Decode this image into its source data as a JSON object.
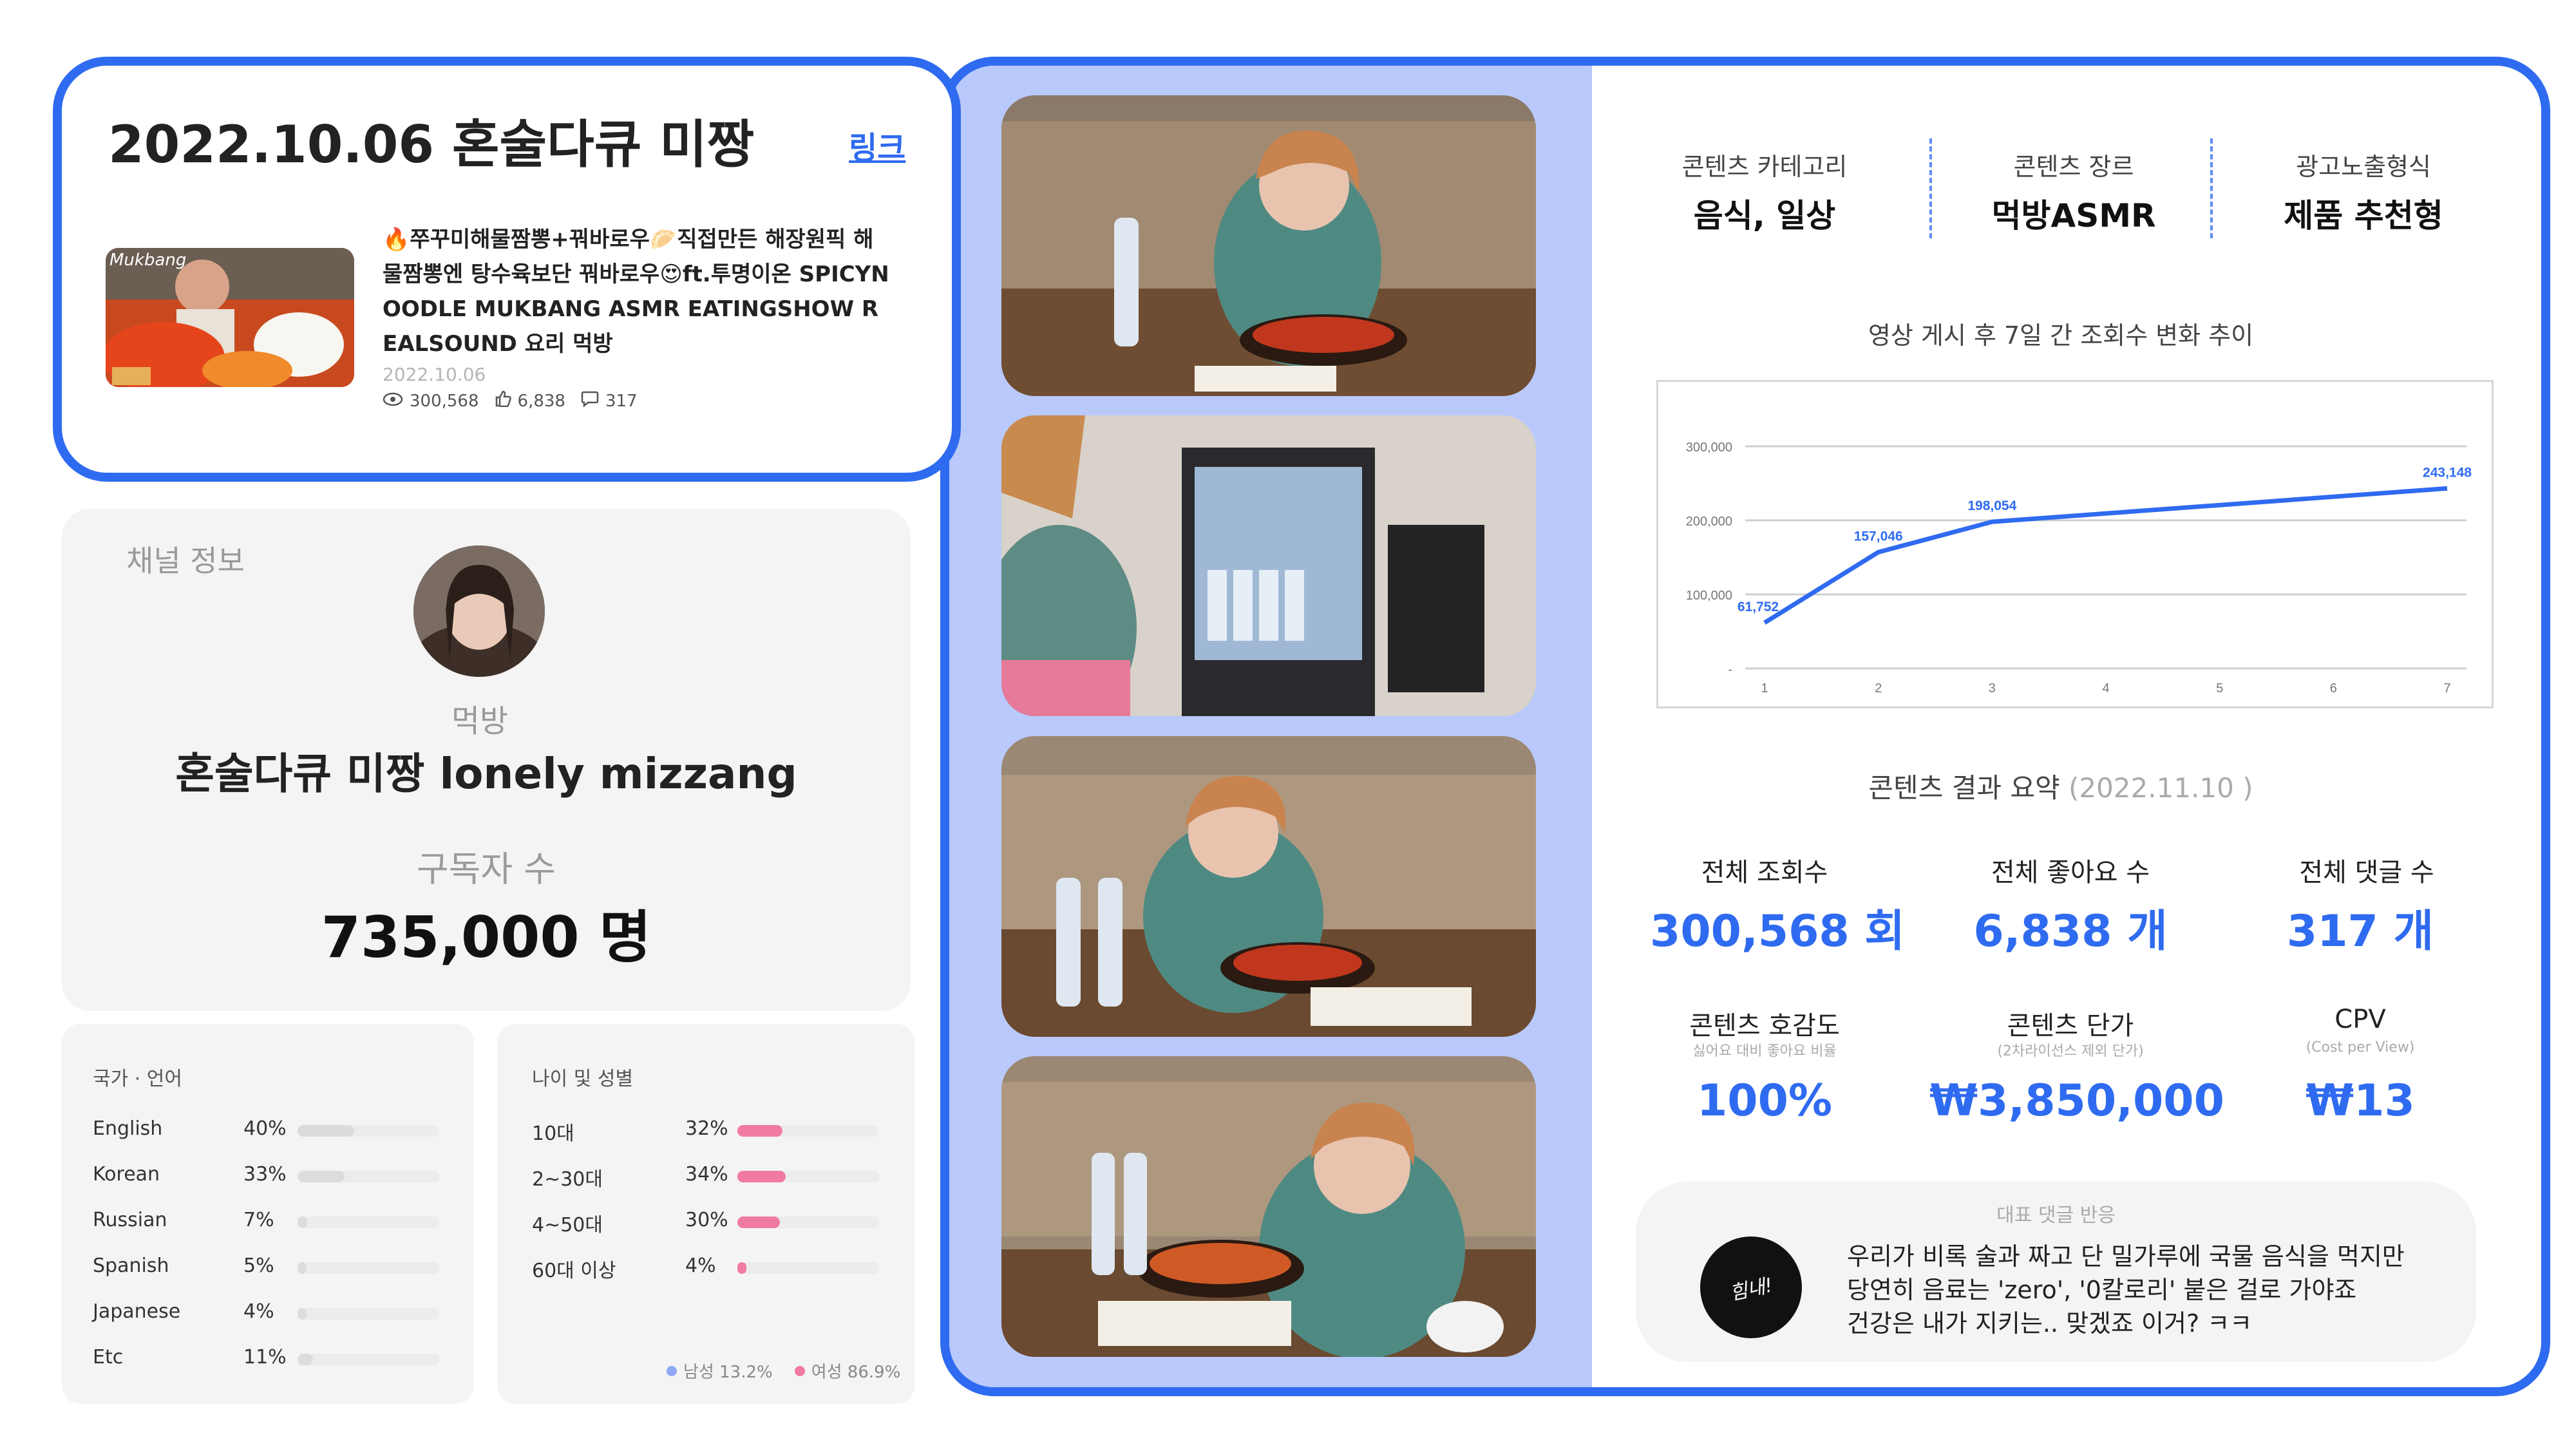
{
  "video_card": {
    "title": "2022.10.06 혼술다큐 미짱",
    "link_label": "링크",
    "thumbnail_tag": "Mukbang",
    "video_title": "🔥쭈꾸미해물짬뽕+꿔바로우🥟직접만든 해장원픽 해물짬뽕엔 탕수육보단 꿔바로우😍ft.투명이온 SPICYNOODLE MUKBANG ASMR EATINGSHOW REALSOUND 요리 먹방",
    "date": "2022.10.06",
    "views": "300,568",
    "likes": "6,838",
    "comments": "317"
  },
  "channel": {
    "section_label": "채널 정보",
    "category": "먹방",
    "name": "혼술다큐 미짱 lonely mizzang",
    "subscribers_label": "구독자 수",
    "subscribers_value": "735,000 명"
  },
  "country_language": {
    "title": "국가 · 언어",
    "rows": [
      {
        "label": "English",
        "pct_text": "40%",
        "pct": 40
      },
      {
        "label": "Korean",
        "pct_text": "33%",
        "pct": 33
      },
      {
        "label": "Russian",
        "pct_text": "7%",
        "pct": 7
      },
      {
        "label": "Spanish",
        "pct_text": "5%",
        "pct": 5
      },
      {
        "label": "Japanese",
        "pct_text": "4%",
        "pct": 4
      },
      {
        "label": "Etc",
        "pct_text": "11%",
        "pct": 11
      }
    ],
    "bar_color": "#dcdcdc"
  },
  "age_gender": {
    "title": "나이 및 성별",
    "rows": [
      {
        "label": "10대",
        "pct_text": "32%",
        "pct": 32
      },
      {
        "label": "2~30대",
        "pct_text": "34%",
        "pct": 34
      },
      {
        "label": "4~50대",
        "pct_text": "30%",
        "pct": 30
      },
      {
        "label": "60대 이상",
        "pct_text": "4%",
        "pct": 4
      }
    ],
    "bar_color": "#f07aa0",
    "legend_male": "남성 13.2%",
    "legend_female": "여성 86.9%",
    "male_color": "#8fa9f5",
    "female_color": "#f07aa0"
  },
  "content_meta": {
    "category_label": "콘텐츠 카테고리",
    "category_value": "음식, 일상",
    "genre_label": "콘텐츠 장르",
    "genre_value": "먹방ASMR",
    "ad_label": "광고노출형식",
    "ad_value": "제품 추천형"
  },
  "chart_title": "영상 게시 후 7일 간 조회수 변화 추이",
  "chart_data": {
    "type": "line",
    "x": [
      1,
      2,
      3,
      4,
      5,
      6,
      7
    ],
    "y_points": [
      {
        "x": 1,
        "y": 61752,
        "label": "61,752"
      },
      {
        "x": 2,
        "y": 157046,
        "label": "157,046"
      },
      {
        "x": 3,
        "y": 198054,
        "label": "198,054"
      },
      {
        "x": 7,
        "y": 243148,
        "label": "243,148"
      }
    ],
    "yticks": [
      "300,000",
      "200,000",
      "100,000",
      "-"
    ],
    "ytick_values": [
      300000,
      200000,
      100000,
      0
    ],
    "xticks": [
      "1",
      "2",
      "3",
      "4",
      "5",
      "6",
      "7"
    ],
    "ylim": [
      0,
      300000
    ],
    "xlim": [
      1,
      7
    ],
    "grid": true,
    "line_color": "#2f6bf0"
  },
  "summary": {
    "title": "콘텐츠 결과 요약",
    "date": "(2022.11.10 )",
    "total_views_label": "전체 조회수",
    "total_views_value": "300,568 회",
    "total_likes_label": "전체 좋아요 수",
    "total_likes_value": "6,838 개",
    "total_comments_label": "전체 댓글 수",
    "total_comments_value": "317 개",
    "favor_label": "콘텐츠 호감도",
    "favor_sub": "싫어요 대비 좋아요 비율",
    "favor_value": "100%",
    "price_label": "콘텐츠 단가",
    "price_sub": "(2차라이선스 제외 단가)",
    "price_value": "₩3,850,000",
    "cpv_label": "CPV",
    "cpv_sub": "(Cost per View)",
    "cpv_value": "₩13"
  },
  "comment": {
    "title": "대표 댓글 반응",
    "avatar_text": "힘내!",
    "line1": "우리가 비록 술과 짜고 단 밀가루에 국물 음식을 먹지만",
    "line2": "당연히 음료는 'zero', '0칼로리' 붙은 걸로 가야죠",
    "line3": "건강은 내가 지키는.. 맞겠죠 이거? ㅋㅋ"
  },
  "colors": {
    "accent": "#2f6bf0",
    "panel_blue": "#b9c9fb"
  }
}
